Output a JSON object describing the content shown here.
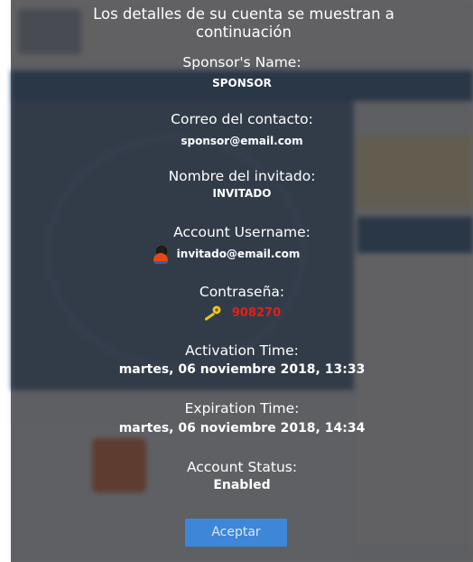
{
  "dialog": {
    "title": "Los detalles de su cuenta se muestran a continuación",
    "sponsor_name_label": "Sponsor's Name:",
    "sponsor_name": "SPONSOR",
    "contact_email_label": "Correo del contacto:",
    "contact_email": "sponsor@email.com",
    "guest_name_label": "Nombre del invitado:",
    "guest_name": "INVITADO",
    "username_label": "Account Username:",
    "username": "invitado@email.com",
    "password_label": "Contraseña:",
    "password": "908270",
    "activation_label": "Activation Time:",
    "activation_time": "martes, 06 noviembre 2018, 13:33",
    "expiration_label": "Expiration Time:",
    "expiration_time": "martes, 06 noviembre 2018, 14:34",
    "status_label": "Account Status:",
    "status": "Enabled",
    "accept_button": "Aceptar"
  },
  "icons": {
    "user": "user-avatar-icon",
    "password": "key-icon"
  },
  "colors": {
    "overlay": "#28282c",
    "password_text": "#e0211b",
    "accept_button": "#3d86d8"
  }
}
